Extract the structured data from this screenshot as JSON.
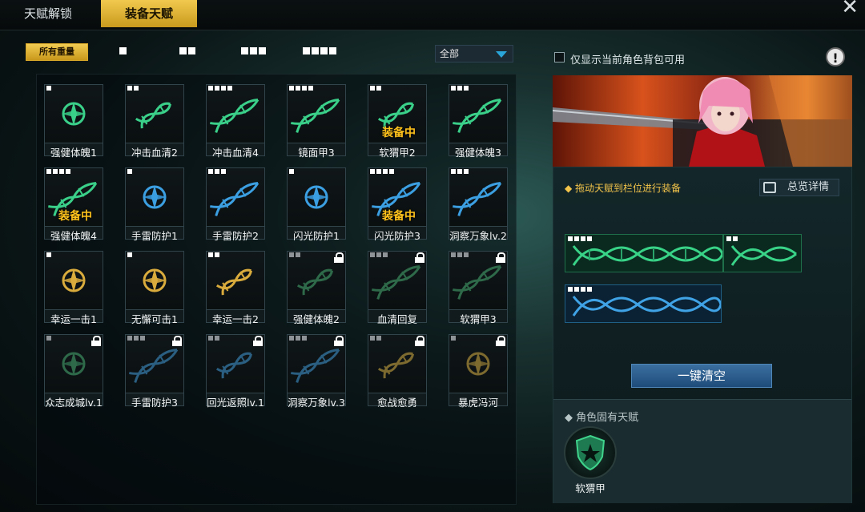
{
  "tabs": [
    {
      "label": "天赋解锁",
      "active": false
    },
    {
      "label": "装备天赋",
      "active": true
    }
  ],
  "filters": {
    "all_label": "所有重量",
    "weights": [
      1,
      2,
      3,
      4
    ]
  },
  "dropdown": {
    "selected": "全部"
  },
  "checkbox": {
    "label": "仅显示当前角色背包可用",
    "checked": false
  },
  "equipped_label": "装备中",
  "talents": [
    {
      "name": "强健体魄1",
      "weight": 1,
      "icon": "green-compass-icon",
      "locked": false,
      "equipped": false
    },
    {
      "name": "冲击血清2",
      "weight": 2,
      "icon": "green-dna-icon",
      "locked": false,
      "equipped": false
    },
    {
      "name": "冲击血清4",
      "weight": 4,
      "icon": "green-dna-icon",
      "locked": false,
      "equipped": false
    },
    {
      "name": "镜面甲3",
      "weight": 4,
      "icon": "green-dna-icon",
      "locked": false,
      "equipped": false
    },
    {
      "name": "软猬甲2",
      "weight": 2,
      "icon": "green-dna-icon",
      "locked": false,
      "equipped": true
    },
    {
      "name": "强健体魄3",
      "weight": 3,
      "icon": "green-dna-icon",
      "locked": false,
      "equipped": false
    },
    {
      "name": "强健体魄4",
      "weight": 4,
      "icon": "green-dna-icon",
      "locked": false,
      "equipped": true
    },
    {
      "name": "手雷防护1",
      "weight": 1,
      "icon": "blue-compass-icon",
      "locked": false,
      "equipped": false
    },
    {
      "name": "手雷防护2",
      "weight": 3,
      "icon": "blue-dna-icon",
      "locked": false,
      "equipped": false
    },
    {
      "name": "闪光防护1",
      "weight": 1,
      "icon": "blue-compass-icon",
      "locked": false,
      "equipped": false
    },
    {
      "name": "闪光防护3",
      "weight": 4,
      "icon": "blue-dna-icon",
      "locked": false,
      "equipped": true
    },
    {
      "name": "洞察万象lv.2",
      "weight": 3,
      "icon": "blue-dna-icon",
      "locked": false,
      "equipped": false
    },
    {
      "name": "幸运一击1",
      "weight": 1,
      "icon": "gold-compass-icon",
      "locked": false,
      "equipped": false
    },
    {
      "name": "无懈可击1",
      "weight": 1,
      "icon": "gold-compass-icon",
      "locked": false,
      "equipped": false
    },
    {
      "name": "幸运一击2",
      "weight": 2,
      "icon": "gold-dna-icon",
      "locked": false,
      "equipped": false
    },
    {
      "name": "强健体魄2",
      "weight": 2,
      "icon": "dark-green-dna-icon",
      "locked": true,
      "equipped": false
    },
    {
      "name": "血清回复",
      "weight": 3,
      "icon": "dark-green-dna-icon",
      "locked": true,
      "equipped": false
    },
    {
      "name": "软猬甲3",
      "weight": 3,
      "icon": "dark-green-dna-icon",
      "locked": true,
      "equipped": false
    },
    {
      "name": "众志成城lv.1",
      "weight": 1,
      "icon": "dark-green-compass-icon",
      "locked": true,
      "equipped": false
    },
    {
      "name": "手雷防护3",
      "weight": 3,
      "icon": "dark-blue-dna-icon",
      "locked": true,
      "equipped": false
    },
    {
      "name": "回光返照lv.1",
      "weight": 2,
      "icon": "dark-blue-dna-icon",
      "locked": true,
      "equipped": false
    },
    {
      "name": "洞察万象lv.3",
      "weight": 3,
      "icon": "dark-blue-dna-icon",
      "locked": true,
      "equipped": false
    },
    {
      "name": "愈战愈勇",
      "weight": 2,
      "icon": "dark-gold-dna-icon",
      "locked": true,
      "equipped": false
    },
    {
      "name": "暴虎冯河",
      "weight": 1,
      "icon": "dark-gold-compass-icon",
      "locked": true,
      "equipped": false
    }
  ],
  "right": {
    "hint": "拖动天赋到栏位进行装备",
    "detail_button": "总览详情",
    "clear_button": "一键清空",
    "innate_title": "角色固有天赋",
    "innate_talent": {
      "name": "软猬甲",
      "icon": "star-shield-icon"
    },
    "equipped_slots": [
      {
        "color": "green",
        "weight": 4
      },
      {
        "color": "green",
        "weight": 2
      },
      {
        "color": "blue",
        "weight": 4
      }
    ]
  },
  "colors": {
    "gold": "#f2c84b",
    "green": "#34c77a",
    "blue": "#3a9ee0",
    "equipped": "#ffc21c"
  }
}
